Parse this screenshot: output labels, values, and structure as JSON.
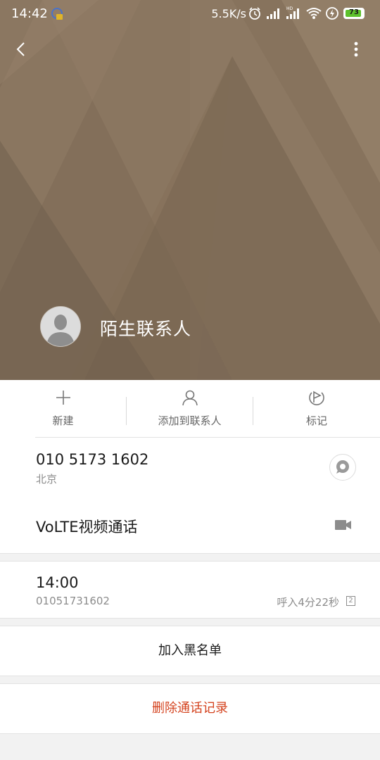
{
  "status_bar": {
    "time": "14:42",
    "network_speed": "5.5K/s",
    "battery_level": "73"
  },
  "contact": {
    "name": "陌生联系人"
  },
  "actions": [
    {
      "label": "新建",
      "icon": "plus-icon"
    },
    {
      "label": "添加到联系人",
      "icon": "person-icon"
    },
    {
      "label": "标记",
      "icon": "flag-icon"
    }
  ],
  "phone": {
    "number": "010 5173 1602",
    "location": "北京",
    "video_call_label": "VoLTE视频通话"
  },
  "call_log": {
    "time": "14:00",
    "number": "01051731602",
    "detail": "呼入4分22秒",
    "sim": "2"
  },
  "buttons": {
    "blacklist": "加入黑名单",
    "delete_log": "删除通话记录"
  },
  "colors": {
    "header_bg": "#8a7660",
    "danger_text": "#d4431f"
  }
}
